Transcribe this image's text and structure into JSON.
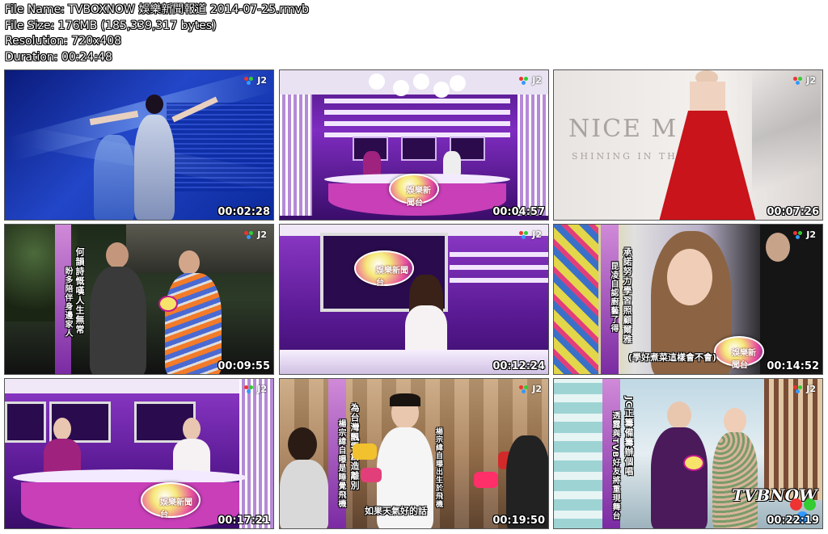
{
  "info": {
    "file_name": "File Name: TVBOXNOW 娛樂新聞報道 2014-07-25.rmvb",
    "file_size": "File Size: 176MB (185,339,317 bytes)",
    "resolution": "Resolution: 720x408",
    "duration": "Duration: 00:24:48"
  },
  "thumbs": [
    {
      "time": "00:02:28"
    },
    {
      "time": "00:04:57"
    },
    {
      "time": "00:07:26"
    },
    {
      "time": "00:09:55"
    },
    {
      "time": "00:12:24"
    },
    {
      "time": "00:14:52"
    },
    {
      "time": "00:17:21"
    },
    {
      "time": "00:19:50"
    },
    {
      "time": "00:22:19"
    }
  ],
  "channel_logo": "J2",
  "show_logo": "娛樂新聞台",
  "captions": {
    "t4_a": "何韻詩慨嘆人生無常",
    "t4_b": "盼多陪伴身邊家人",
    "t3_bg": "NICE M",
    "t3_bg2": "SHINING IN THE",
    "t6_a": "承諾努力學習照顧爾雅",
    "t6_b": "昆凌自認廚藝了得",
    "t6_sub": "(學好煮菜這樣會不會)",
    "t8_a": "為台灣飄零創造離別",
    "t8_b": "楊宗緯自曝是睡覺飛機",
    "t8_sub": "如果天氣好的話",
    "t8_mid": "楊宗緯自曝出生於飛機",
    "t9_a": "JC正籌備籌辦個唱",
    "t9_b": "透露與TVB好友將重現舞台",
    "t9_brand": "TVBNOW"
  },
  "colors": {
    "purple": "#6b1fa0",
    "magenta": "#c22fb3",
    "red_dress": "#c8141a",
    "blue_stage": "#2246c8"
  }
}
